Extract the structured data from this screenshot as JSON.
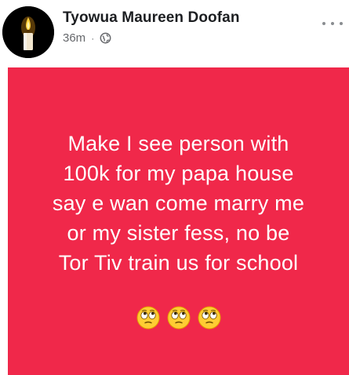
{
  "post": {
    "author": "Tyowua Maureen Doofan",
    "time": "36m",
    "separator": "·",
    "privacy_icon": "globe-icon",
    "avatar_icon": "candle-icon",
    "more_icon": "more-options-icon"
  },
  "card": {
    "background_color": "#f0284a",
    "text_color": "#ffffff",
    "lines": [
      "Make I see person with",
      "100k for my papa house",
      "say e wan come marry me",
      "or my sister fess, no be",
      "Tor Tiv train us for school"
    ],
    "emojis": [
      "eye-roll-emoji",
      "eye-roll-emoji",
      "eye-roll-emoji"
    ]
  }
}
